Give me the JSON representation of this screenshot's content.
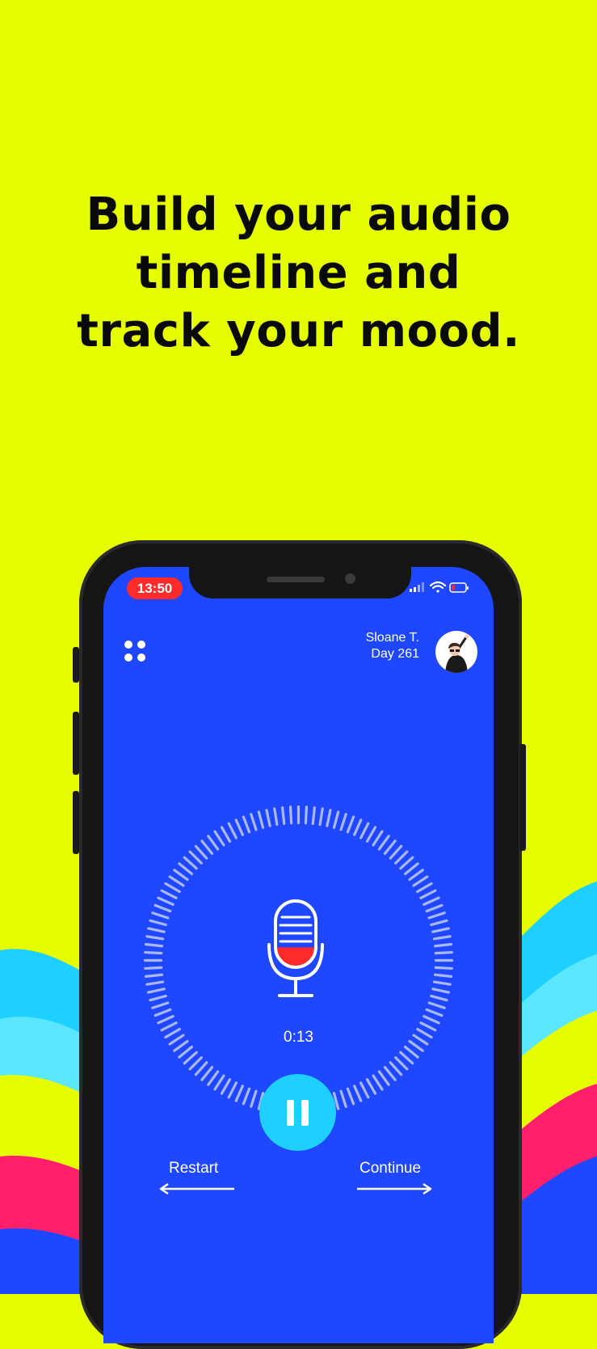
{
  "headline": {
    "line1": "Build your audio",
    "line2": "timeline and",
    "line3": "track your mood."
  },
  "colors": {
    "background": "#e6ff00",
    "screen": "#1f47ff",
    "accent_cyan": "#1ed0ff",
    "recording_red": "#ff2a2a",
    "wave_pink": "#ff1f6d",
    "wave_sky": "#5ae7ff"
  },
  "status_bar": {
    "time": "13:50",
    "icons": [
      "signal-icon",
      "wifi-icon",
      "battery-icon"
    ]
  },
  "header": {
    "menu_icon": "grid-menu-icon",
    "user_name": "Sloane T.",
    "user_day": "Day 261",
    "avatar_icon": "avatar"
  },
  "recorder": {
    "icon": "microphone-icon",
    "elapsed": "0:13",
    "level": 0.3,
    "pause_icon": "pause-icon"
  },
  "navigation": {
    "restart_label": "Restart",
    "continue_label": "Continue"
  }
}
